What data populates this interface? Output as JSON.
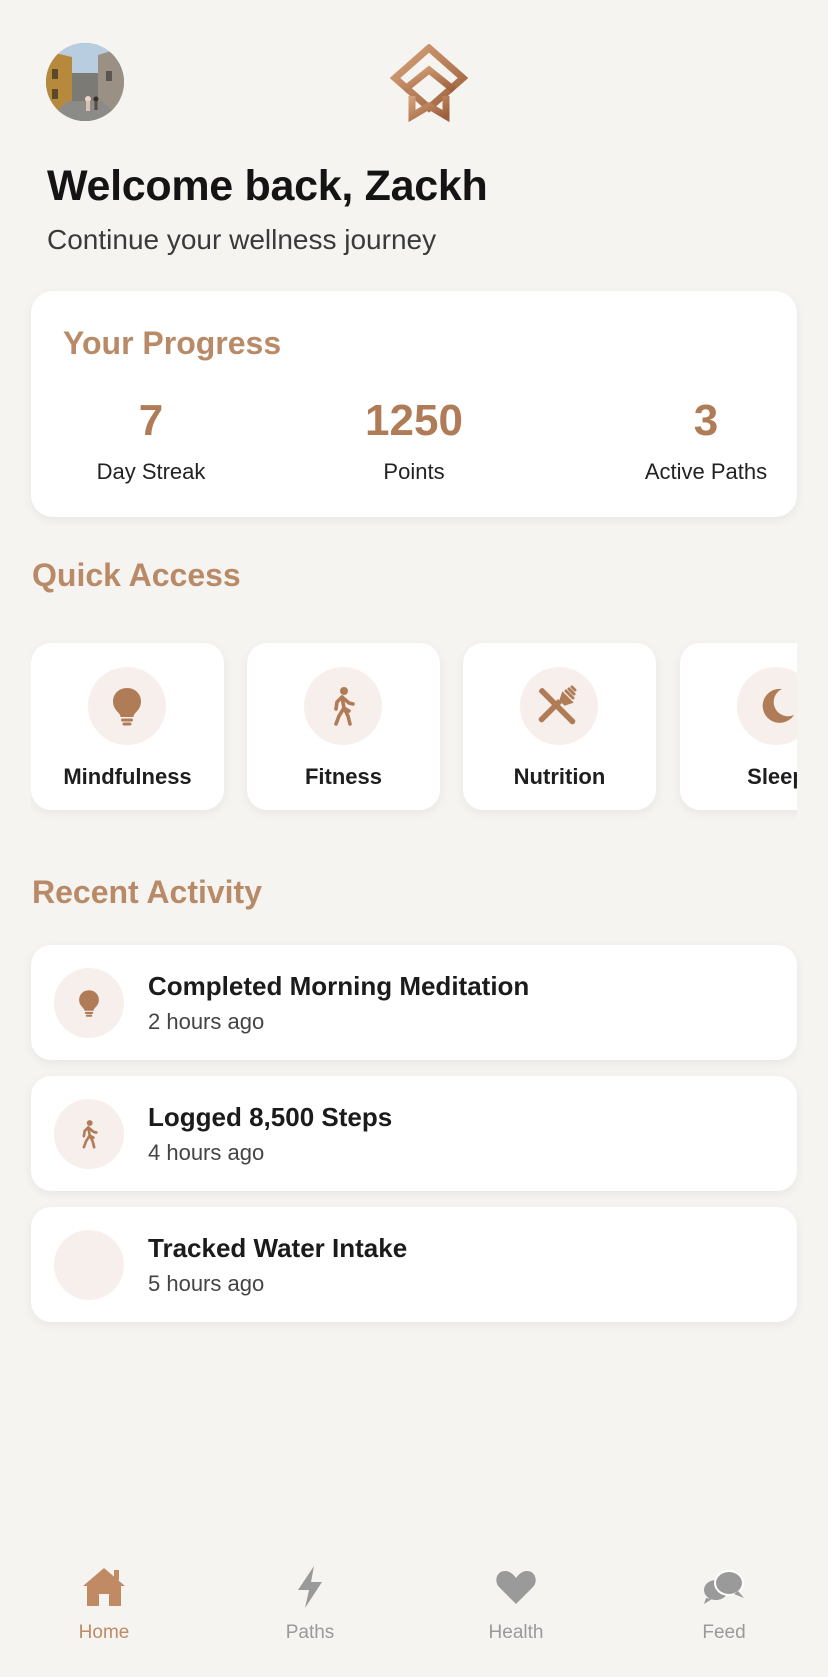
{
  "header": {
    "welcome": "Welcome back, Zackh",
    "subtitle": "Continue your wellness journey",
    "avatar_icon": "profile-photo",
    "logo_icon": "brand-logo"
  },
  "progress": {
    "title": "Your Progress",
    "stats": [
      {
        "value": "7",
        "label": "Day Streak"
      },
      {
        "value": "1250",
        "label": "Points"
      },
      {
        "value": "3",
        "label": "Active Paths"
      }
    ]
  },
  "quick_access": {
    "title": "Quick Access",
    "items": [
      {
        "label": "Mindfulness",
        "icon": "lightbulb-icon"
      },
      {
        "label": "Fitness",
        "icon": "walking-icon"
      },
      {
        "label": "Nutrition",
        "icon": "utensils-icon"
      },
      {
        "label": "Sleep",
        "icon": "moon-icon"
      }
    ]
  },
  "recent_activity": {
    "title": "Recent Activity",
    "items": [
      {
        "title": "Completed Morning Meditation",
        "time": "2 hours ago",
        "icon": "lightbulb-icon"
      },
      {
        "title": "Logged 8,500 Steps",
        "time": "4 hours ago",
        "icon": "walking-icon"
      },
      {
        "title": "Tracked Water Intake",
        "time": "5 hours ago",
        "icon": "blank-icon"
      }
    ]
  },
  "nav": {
    "items": [
      {
        "label": "Home",
        "icon": "home-icon",
        "active": true
      },
      {
        "label": "Paths",
        "icon": "bolt-icon",
        "active": false
      },
      {
        "label": "Health",
        "icon": "heart-icon",
        "active": false
      },
      {
        "label": "Feed",
        "icon": "chat-bubbles-icon",
        "active": false
      }
    ]
  },
  "colors": {
    "accent": "#b98a68",
    "accent_dark": "#b07c58",
    "background": "#f6f4f1",
    "icon_bg": "#f7efeb",
    "nav_inactive": "#9a9a9a"
  }
}
